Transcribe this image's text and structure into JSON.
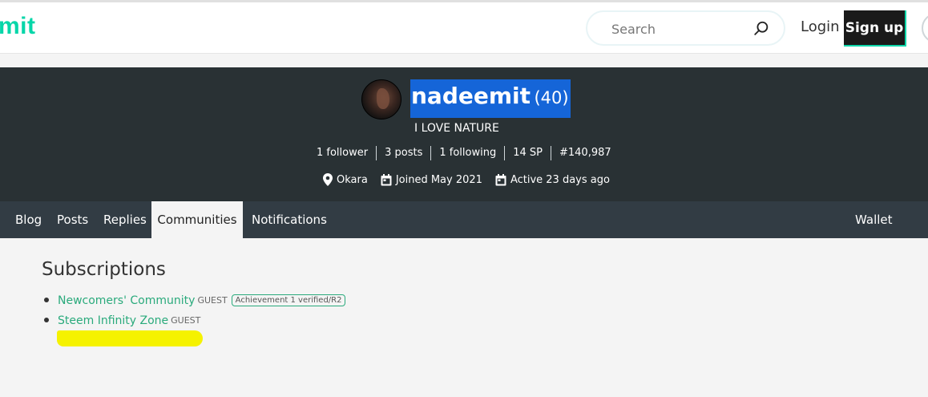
{
  "header": {
    "logo_text": "mit",
    "search_placeholder": "Search",
    "login_label": "Login",
    "signup_label": "Sign up"
  },
  "profile": {
    "name": "nadeemit",
    "reputation": "(40)",
    "about": "I LOVE NATURE",
    "stats": [
      "1 follower",
      "3 posts",
      "1 following",
      "14 SP",
      "#140,987"
    ],
    "location": "Okara",
    "joined": "Joined May 2021",
    "active": "Active 23 days ago"
  },
  "tabs": {
    "items": [
      "Blog",
      "Posts",
      "Replies",
      "Communities",
      "Notifications"
    ],
    "active": "Communities",
    "wallet": "Wallet"
  },
  "subscriptions": {
    "title": "Subscriptions",
    "items": [
      {
        "name": "Newcomers' Community",
        "role": "GUEST",
        "badge": "Achievement 1 verified/R2"
      },
      {
        "name": "Steem Infinity Zone",
        "role": "GUEST"
      }
    ]
  },
  "colors": {
    "accent": "#06d6a9",
    "link": "#2aaa7c",
    "banner": "#293134",
    "tabs": "#323c44",
    "selection": "#1565d8",
    "highlight": "#f5f200"
  }
}
